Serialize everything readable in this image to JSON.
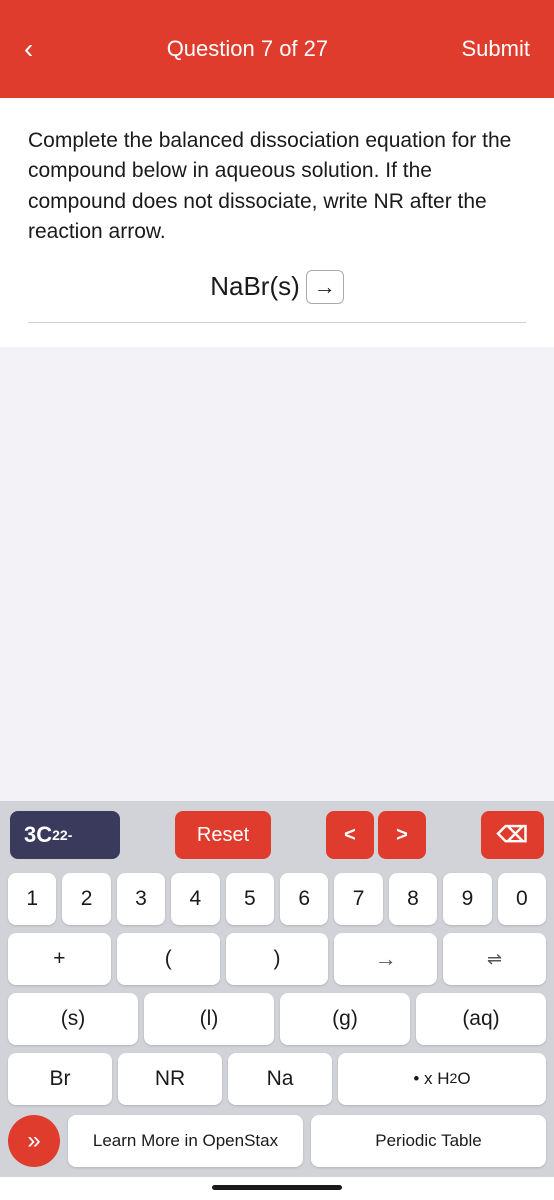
{
  "header": {
    "back_icon": "‹",
    "title": "Question 7 of 27",
    "submit_label": "Submit"
  },
  "question": {
    "text": "Complete the balanced dissociation equation for the compound below in aqueous solution. If the compound does not dissociate, write NR after the reaction arrow.",
    "equation_compound": "NaBr(s)",
    "equation_arrow": "→"
  },
  "keyboard": {
    "input_display": "3C₂²⁻",
    "reset_label": "Reset",
    "nav_left": "<",
    "nav_right": ">",
    "delete_icon": "⌫",
    "number_keys": [
      "1",
      "2",
      "3",
      "4",
      "5",
      "6",
      "7",
      "8",
      "9",
      "0"
    ],
    "row2_keys": [
      "+",
      "(",
      ")",
      "→",
      "⇌"
    ],
    "row3_keys": [
      "(s)",
      "(l)",
      "(g)",
      "(aq)"
    ],
    "row4_keys": [
      "Br",
      "NR",
      "Na",
      "• x H₂O"
    ],
    "footer": {
      "skip_icon": "»",
      "learn_more_label": "Learn More in OpenStax",
      "periodic_table_label": "Periodic Table"
    }
  }
}
